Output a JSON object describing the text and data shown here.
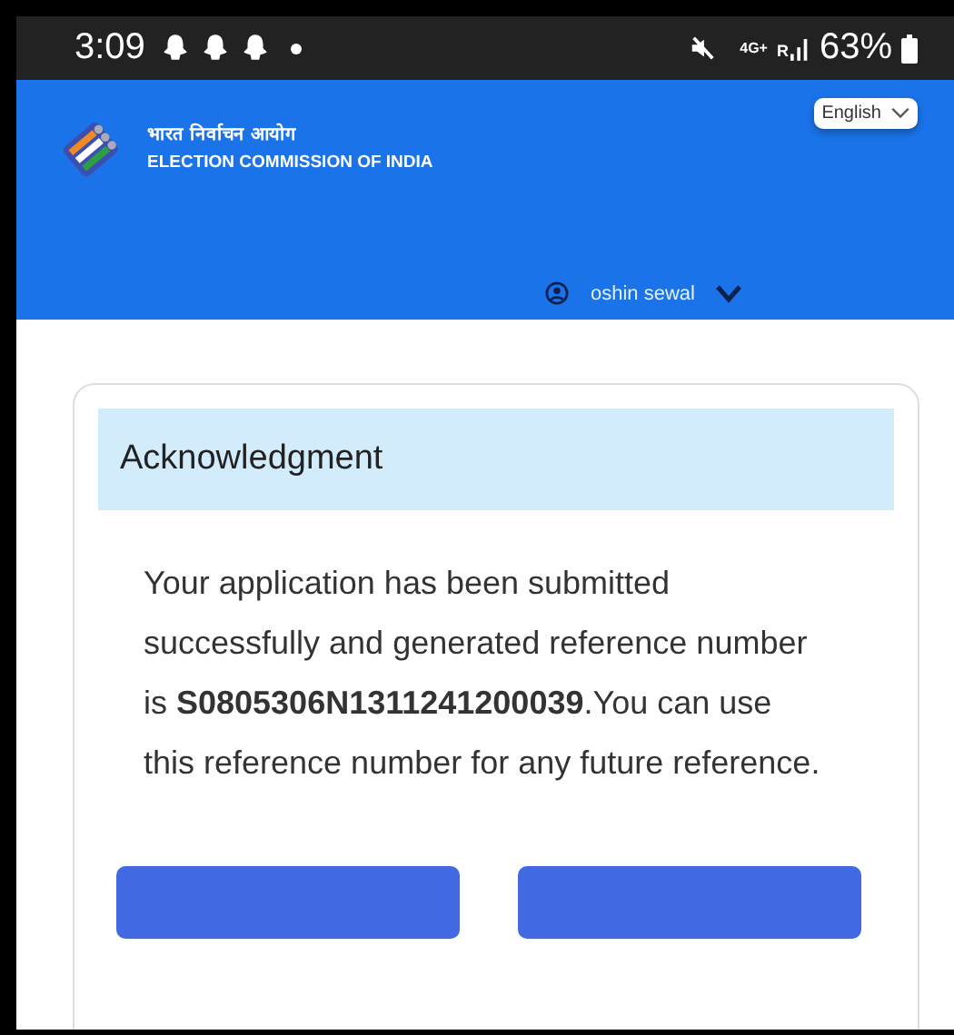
{
  "status_bar": {
    "time": "3:09",
    "network": "4G+",
    "roaming": "R",
    "battery": "63%"
  },
  "header": {
    "org_hindi": "भारत निर्वाचन आयोग",
    "org_english": "ELECTION COMMISSION OF INDIA",
    "language": "English",
    "user": "oshin sewal"
  },
  "card": {
    "title": "Acknowledgment",
    "message": "Your application has been submitted successfully and generated reference number is **S0805306N1311241200039**.You can use this reference number for any future reference.",
    "buttons": [
      {
        "kind": "primary"
      },
      {
        "kind": "primary"
      }
    ]
  }
}
